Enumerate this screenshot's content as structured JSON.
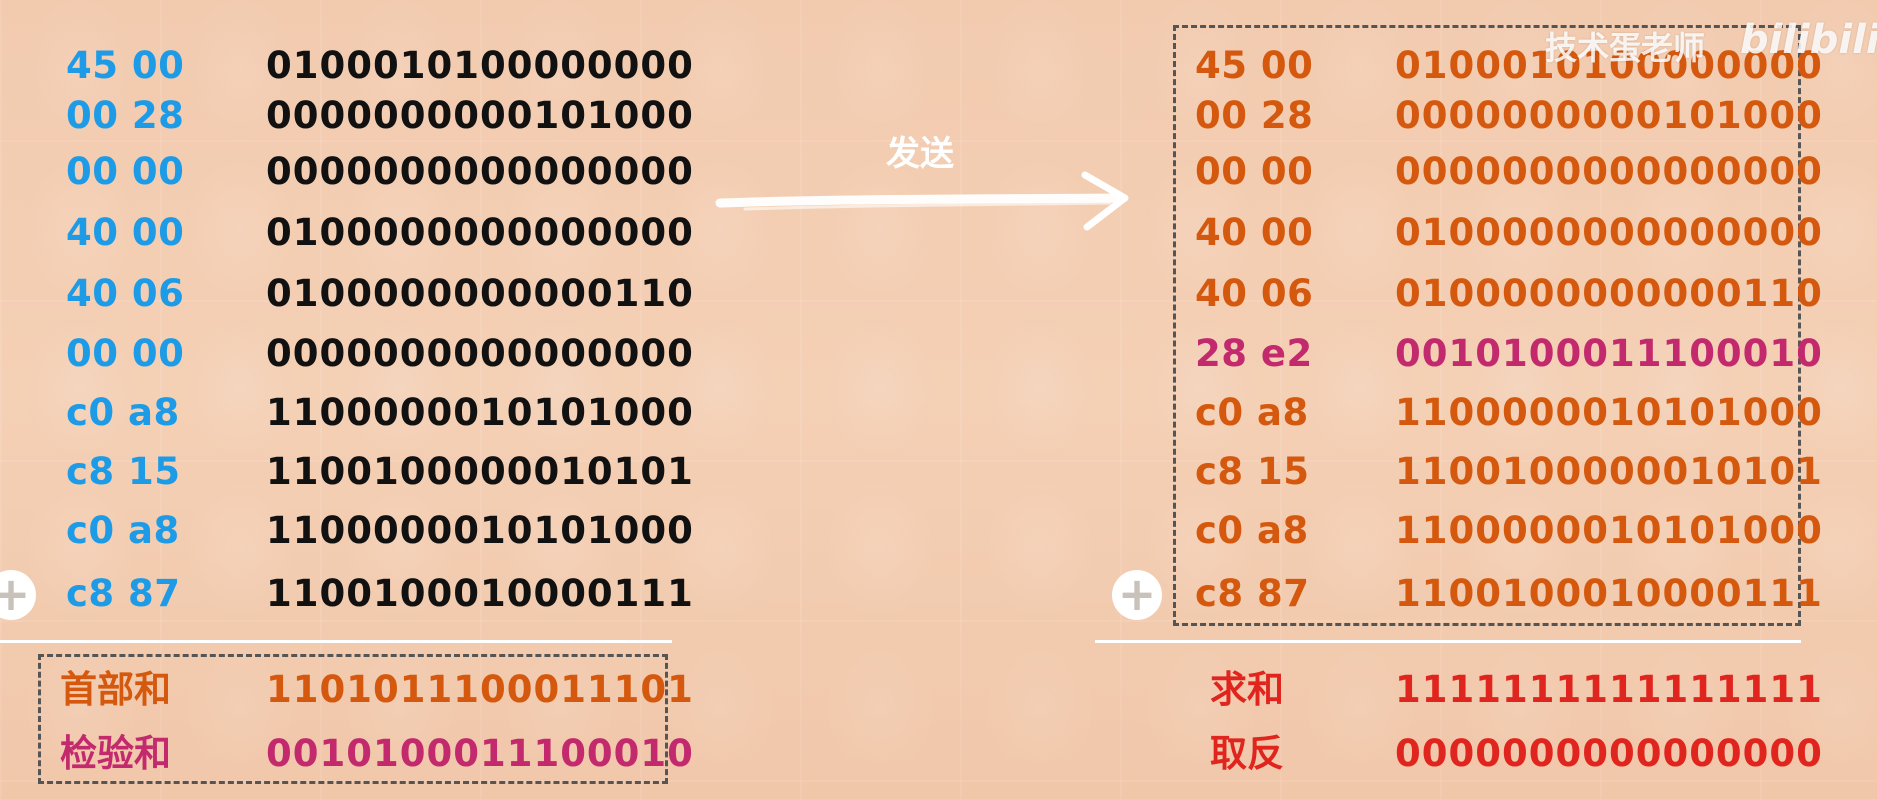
{
  "watermark": {
    "author": "技术蛋老师",
    "platform_logo": "bilibili"
  },
  "send_label": "发送",
  "left_rows": [
    {
      "hex": "45 00",
      "bin": "0100010100000000"
    },
    {
      "hex": "00 28",
      "bin": "0000000000101000"
    },
    {
      "hex": "00 00",
      "bin": "0000000000000000"
    },
    {
      "hex": "40 00",
      "bin": "0100000000000000"
    },
    {
      "hex": "40 06",
      "bin": "0100000000000110"
    },
    {
      "hex": "00 00",
      "bin": "0000000000000000"
    },
    {
      "hex": "c0 a8",
      "bin": "1100000010101000"
    },
    {
      "hex": "c8 15",
      "bin": "1100100000010101"
    },
    {
      "hex": "c0 a8",
      "bin": "1100000010101000"
    },
    {
      "hex": "c8 87",
      "bin": "1100100010000111"
    }
  ],
  "left_results": [
    {
      "label": "首部和",
      "bin": "1101011100011101"
    },
    {
      "label": "检验和",
      "bin": "0010100011100010"
    }
  ],
  "right_rows": [
    {
      "hex": "45 00",
      "bin": "0100010100000000"
    },
    {
      "hex": "00 28",
      "bin": "0000000000101000"
    },
    {
      "hex": "00 00",
      "bin": "0000000000000000"
    },
    {
      "hex": "40 00",
      "bin": "0100000000000000"
    },
    {
      "hex": "40 06",
      "bin": "0100000000000110"
    },
    {
      "hex": "28 e2",
      "bin": "0010100011100010"
    },
    {
      "hex": "c0 a8",
      "bin": "1100000010101000"
    },
    {
      "hex": "c8 15",
      "bin": "1100100000010101"
    },
    {
      "hex": "c0 a8",
      "bin": "1100000010101000"
    },
    {
      "hex": "c8 87",
      "bin": "1100100010000111"
    }
  ],
  "right_results": [
    {
      "label": "求和",
      "bin": "1111111111111111"
    },
    {
      "label": "取反",
      "bin": "0000000000000000"
    }
  ],
  "plus_symbol": "+",
  "colors": {
    "hex_left": "#1e9be6",
    "bin_left": "#111111",
    "right_text": "#d4590e",
    "checksum": "#c22a6d",
    "result_red": "#e0251e",
    "background": "#f3cfb4"
  },
  "highlighted_right_row_index": 5
}
